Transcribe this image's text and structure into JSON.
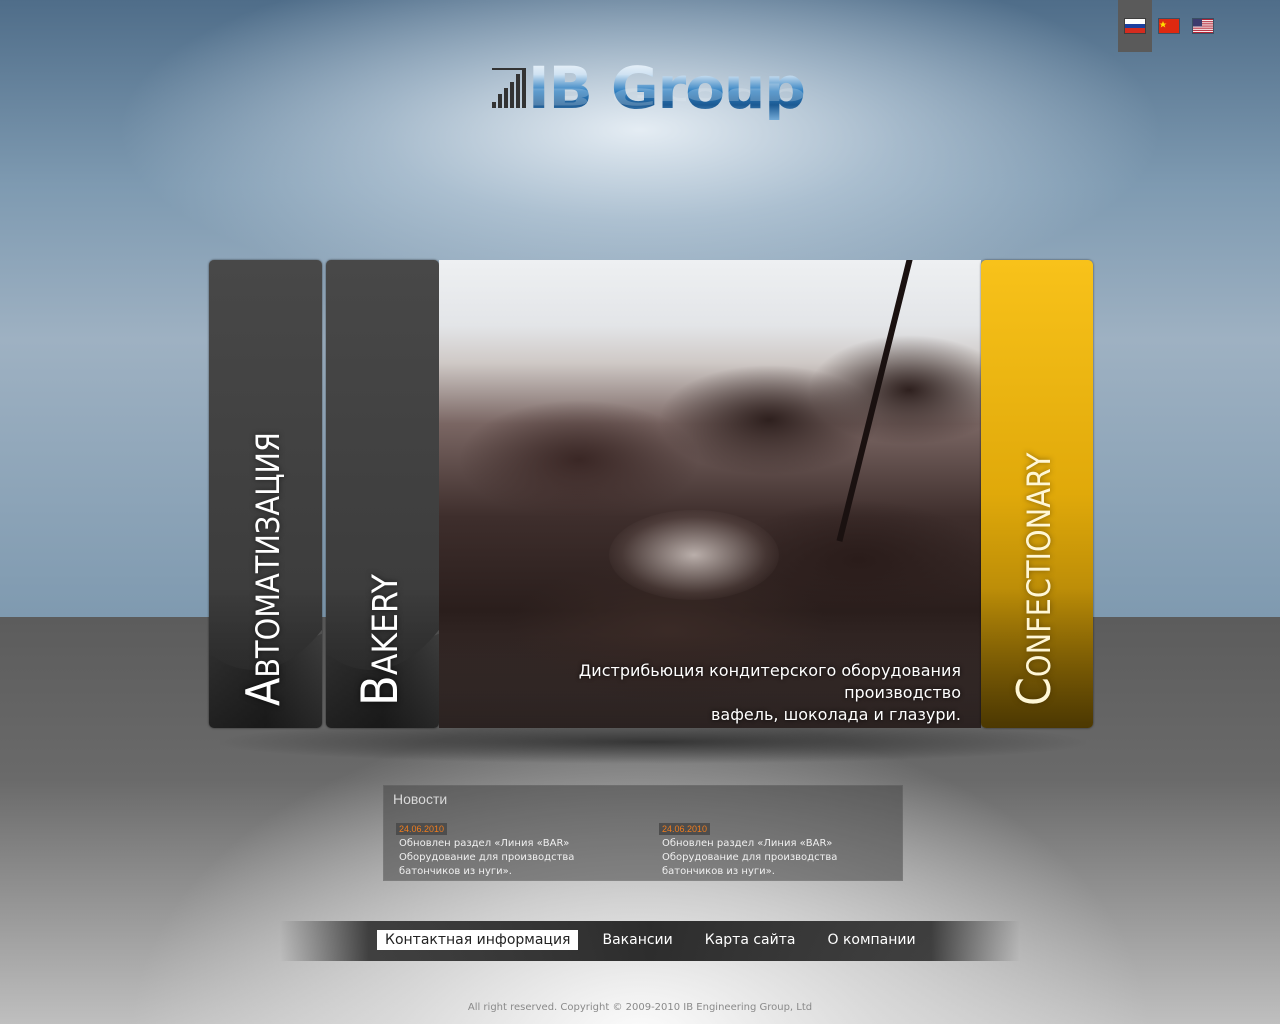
{
  "languages": [
    {
      "code": "ru",
      "icon": "flag-russia-icon",
      "active": true
    },
    {
      "code": "zh",
      "icon": "flag-china-icon",
      "active": false
    },
    {
      "code": "en",
      "icon": "flag-usa-icon",
      "active": false
    }
  ],
  "logo": {
    "text": "IB Group",
    "icon": "equalizer-bars-icon"
  },
  "panels": {
    "automation": "Автоматизация",
    "bakery": "Bakery",
    "confectionary": "Confectionary"
  },
  "hero": {
    "caption_line1": "Дистрибьюция кондитерского оборудования производство",
    "caption_line2": "вафель, шоколада и глазури."
  },
  "news": {
    "title": "Новости",
    "items": [
      {
        "date": "24.06.2010",
        "text": "Обновлен раздел «Линия «BAR» Оборудование для производства батончиков из нуги»."
      },
      {
        "date": "24.06.2010",
        "text": "Обновлен раздел «Линия «BAR» Оборудование для производства батончиков из нуги»."
      }
    ]
  },
  "menu": {
    "items": [
      "Контактная информация",
      "Вакансии",
      "Карта сайта",
      "О компании"
    ]
  },
  "footer": {
    "copyright": "All right reserved. Copyright © 2009-2010 IB Engineering Group, Ltd"
  },
  "colors": {
    "accent_yellow": "#f8c21a",
    "news_date": "#f07d1e",
    "logo_blue": "#2f7fc0"
  }
}
